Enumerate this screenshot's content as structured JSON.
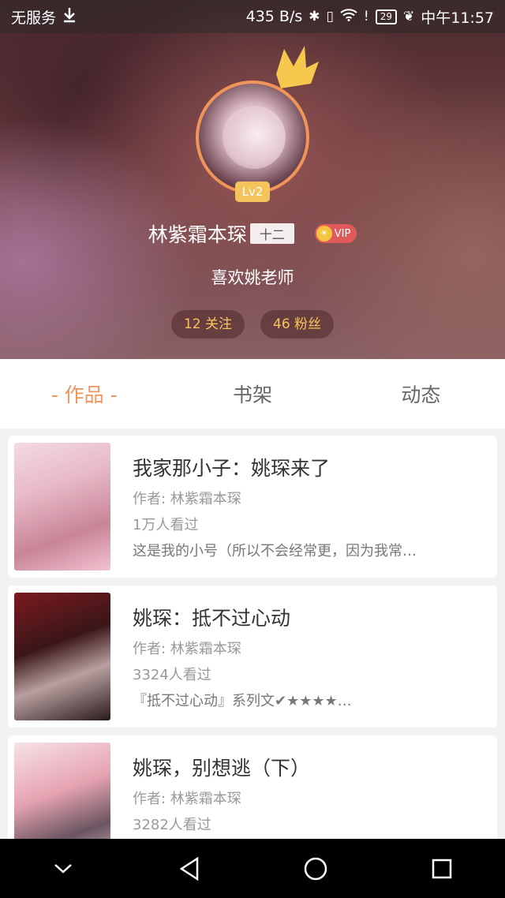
{
  "status_bar": {
    "carrier": "无服务",
    "speed": "435 B/s",
    "battery": "29",
    "time": "中午11:57"
  },
  "profile": {
    "level": "Lv2",
    "username": "林紫霜本琛",
    "name_tag": "十二",
    "vip": "VIP",
    "signature": "喜欢姚老师",
    "following": "12 关注",
    "followers": "46 粉丝"
  },
  "tabs": [
    {
      "label": "- 作品 -",
      "active": true
    },
    {
      "label": "书架",
      "active": false
    },
    {
      "label": "动态",
      "active": false
    }
  ],
  "books": [
    {
      "title": "我家那小子：姚琛来了",
      "author": "作者: 林紫霜本琛",
      "views": "1万人看过",
      "description": "这是我的小号（所以不会经常更，因为我常…"
    },
    {
      "title": "姚琛：抵不过心动",
      "author": "作者: 林紫霜本琛",
      "views": "3324人看过",
      "description": "『抵不过心动』系列文✔★★★★…"
    },
    {
      "title": "姚琛，别想逃（下）",
      "author": "作者: 林紫霜本琛",
      "views": "3282人看过",
      "description": ""
    }
  ],
  "colors": {
    "accent": "#f0955a",
    "stat_text": "#f6c45a",
    "vip": "#e05a5a"
  }
}
